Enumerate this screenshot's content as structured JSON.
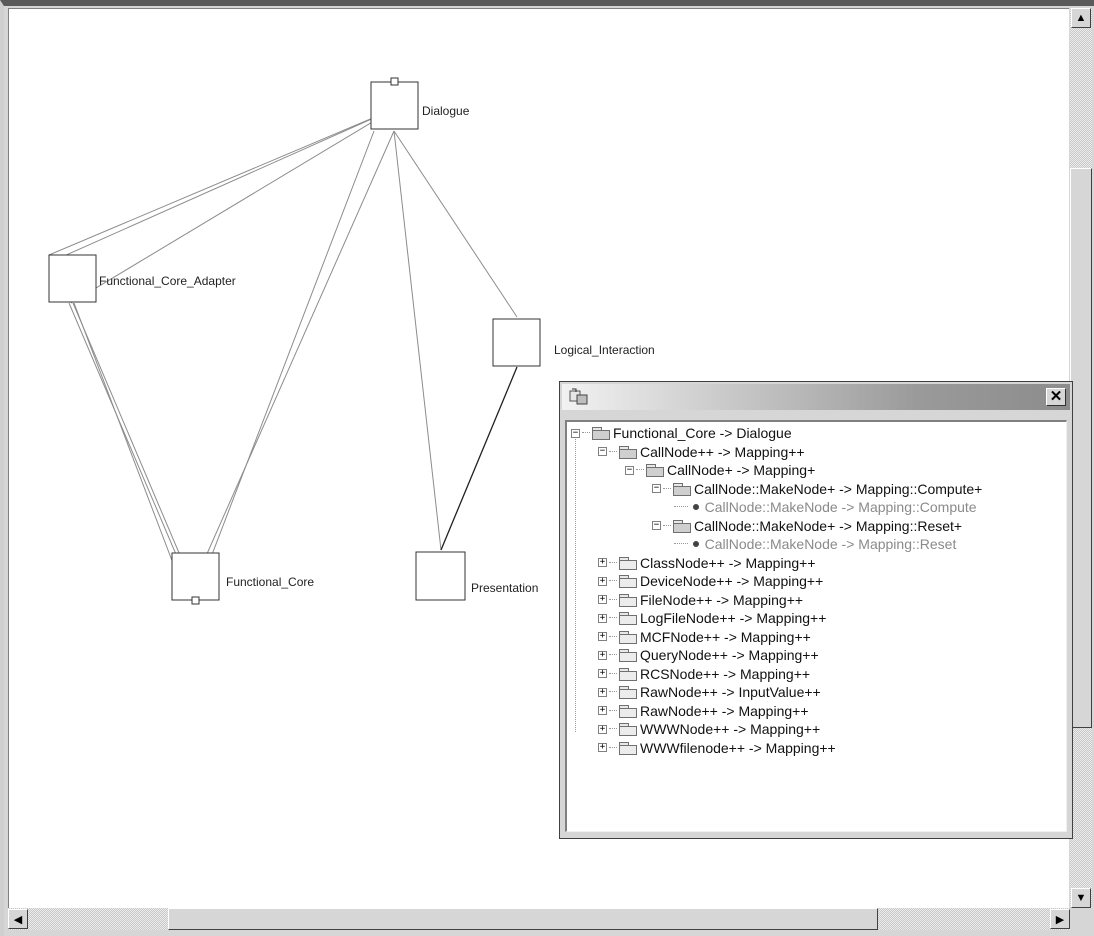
{
  "graph": {
    "nodes": [
      {
        "id": "dialogue",
        "label": "Dialogue"
      },
      {
        "id": "fca",
        "label": "Functional_Core_Adapter"
      },
      {
        "id": "logical",
        "label": "Logical_Interaction"
      },
      {
        "id": "core",
        "label": "Functional_Core"
      },
      {
        "id": "presentation",
        "label": "Presentation"
      }
    ]
  },
  "tree_panel": {
    "close_glyph": "✕",
    "items": [
      {
        "label": "Functional_Core -> Dialogue",
        "state": "expanded",
        "kind": "folder"
      },
      {
        "label": "CallNode++ -> Mapping++",
        "state": "expanded",
        "kind": "folder"
      },
      {
        "label": "CallNode+ -> Mapping+",
        "state": "expanded",
        "kind": "folder"
      },
      {
        "label": "CallNode::MakeNode+ -> Mapping::Compute+",
        "state": "expanded",
        "kind": "folder"
      },
      {
        "label": "CallNode::MakeNode -> Mapping::Compute",
        "state": "leaf",
        "kind": "leaf"
      },
      {
        "label": "CallNode::MakeNode+ -> Mapping::Reset+",
        "state": "expanded",
        "kind": "folder"
      },
      {
        "label": "CallNode::MakeNode -> Mapping::Reset",
        "state": "leaf",
        "kind": "leaf"
      },
      {
        "label": "ClassNode++ -> Mapping++",
        "state": "collapsed",
        "kind": "folder"
      },
      {
        "label": "DeviceNode++ -> Mapping++",
        "state": "collapsed",
        "kind": "folder"
      },
      {
        "label": "FileNode++ -> Mapping++",
        "state": "collapsed",
        "kind": "folder"
      },
      {
        "label": "LogFileNode++ -> Mapping++",
        "state": "collapsed",
        "kind": "folder"
      },
      {
        "label": "MCFNode++ -> Mapping++",
        "state": "collapsed",
        "kind": "folder"
      },
      {
        "label": "QueryNode++ -> Mapping++",
        "state": "collapsed",
        "kind": "folder"
      },
      {
        "label": "RCSNode++ -> Mapping++",
        "state": "collapsed",
        "kind": "folder"
      },
      {
        "label": "RawNode++ -> InputValue++",
        "state": "collapsed",
        "kind": "folder"
      },
      {
        "label": "RawNode++ -> Mapping++",
        "state": "collapsed",
        "kind": "folder"
      },
      {
        "label": "WWWNode++ -> Mapping++",
        "state": "collapsed",
        "kind": "folder"
      },
      {
        "label": "WWWfilenode++ -> Mapping++",
        "state": "collapsed",
        "kind": "folder"
      }
    ]
  },
  "scrollbars": {
    "up_arrow": "▲",
    "down_arrow": "▼",
    "left_arrow": "◀",
    "right_arrow": "▶"
  },
  "colors": {
    "edge": "#8c8c8c",
    "selected_edge": "#202020",
    "node_border": "#333333"
  }
}
